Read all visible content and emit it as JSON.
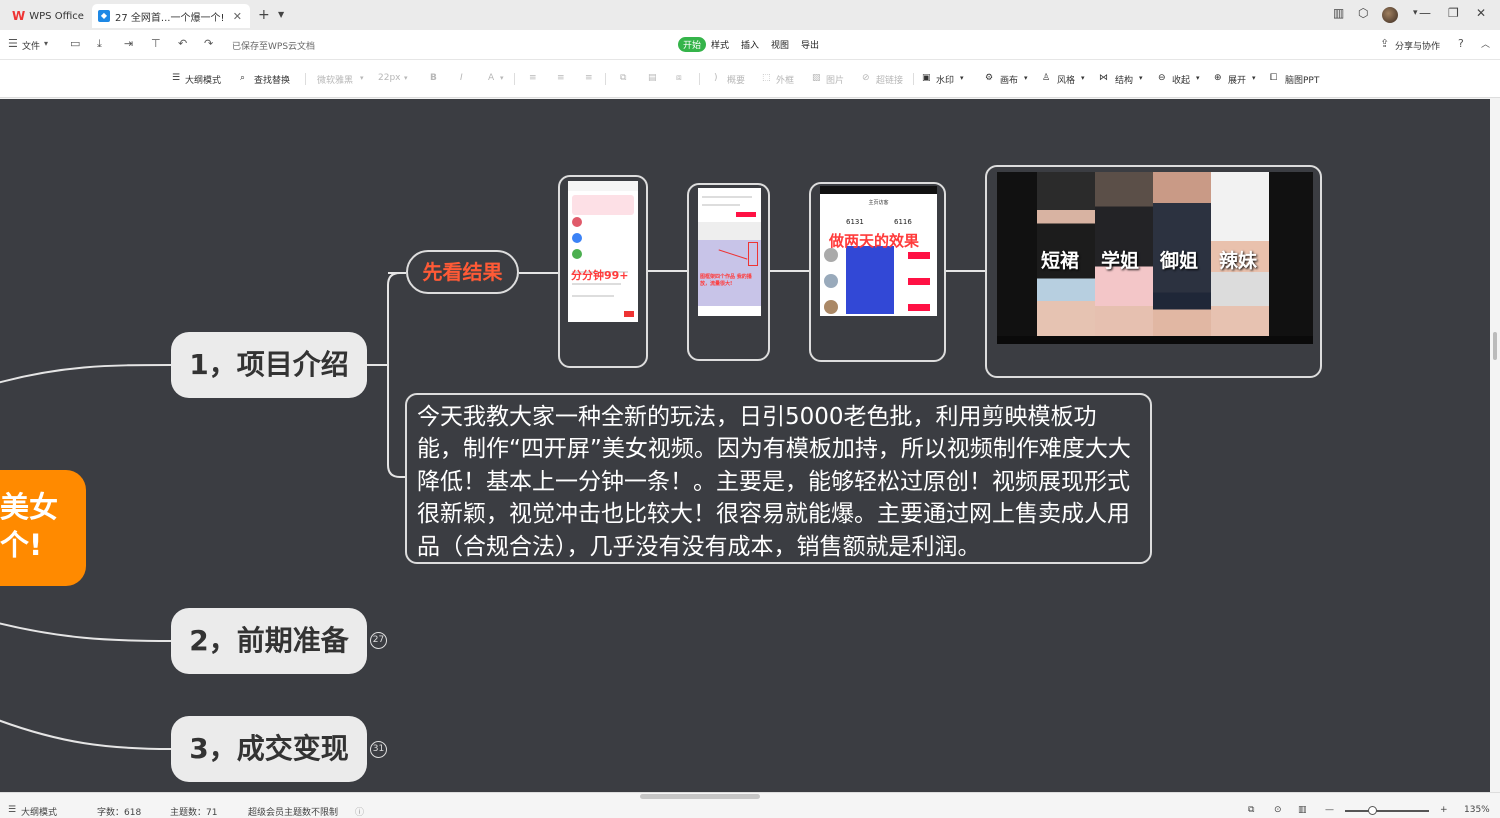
{
  "tabs": {
    "app": "WPS Office",
    "document": "27 全网首...一个爆一个!",
    "new_tab": "+"
  },
  "menubar": {
    "file": "文件",
    "saved_status": "已保存至WPS云文档",
    "tabs": [
      "开始",
      "样式",
      "插入",
      "视图",
      "导出"
    ],
    "share": "分享与协作",
    "help": "?"
  },
  "toolbar": {
    "outline_mode": "大纲模式",
    "find_replace": "查找替换",
    "font_name": "微软雅黑",
    "font_size": "22px",
    "bold": "B",
    "italic": "I",
    "font_color": "A",
    "summary": "概要",
    "frame": "外框",
    "image": "图片",
    "hyperlink": "超链接",
    "watermark": "水印",
    "canvas": "画布",
    "style": "风格",
    "structure": "结构",
    "collapse": "收起",
    "expand": "展开",
    "mind_ppt": "脑图PPT"
  },
  "mindmap": {
    "root_lines": [
      "美女",
      "个!"
    ],
    "branches": [
      {
        "label": "1，项目介绍",
        "badge": ""
      },
      {
        "label": "2，前期准备",
        "badge": "27"
      },
      {
        "label": "3，成交变现",
        "badge": "31"
      }
    ],
    "result_node": "先看结果",
    "screenshots": {
      "phone1_overlay": "分分钟99+",
      "phone3_overlay": "做两天的效果",
      "phone3_stats": [
        "6131",
        "6116"
      ],
      "phone3_title": "主页访客",
      "phone2_caption": "图框架四个作品 我的播放，流量很大!",
      "collage_labels": [
        "短裙",
        "学姐",
        "御姐",
        "辣妹"
      ]
    },
    "description": "今天我教大家一种全新的玩法，日引5000老色批，利用剪映模板功能，制作“四开屏”美女视频。因为有模板加持，所以视频制作难度大大降低！基本上一分钟一条！。主要是，能够轻松过原创！视频展现形式很新颖，视觉冲击也比较大！很容易就能爆。主要通过网上售卖成人用品（合规合法），几乎没有没有成本，销售额就是利润。"
  },
  "statusbar": {
    "outline_mode": "大纲模式",
    "word_count": "字数：618",
    "topic_count": "主题数：71",
    "member_note": "超级会员主题数不限制",
    "zoom": "135%"
  },
  "colors": {
    "canvas_bg": "#3b3d42",
    "root_orange": "#ff8a00",
    "result_red": "#ff5a36",
    "active_tab_green": "#35b44a",
    "branch_bg": "#ebebeb"
  }
}
